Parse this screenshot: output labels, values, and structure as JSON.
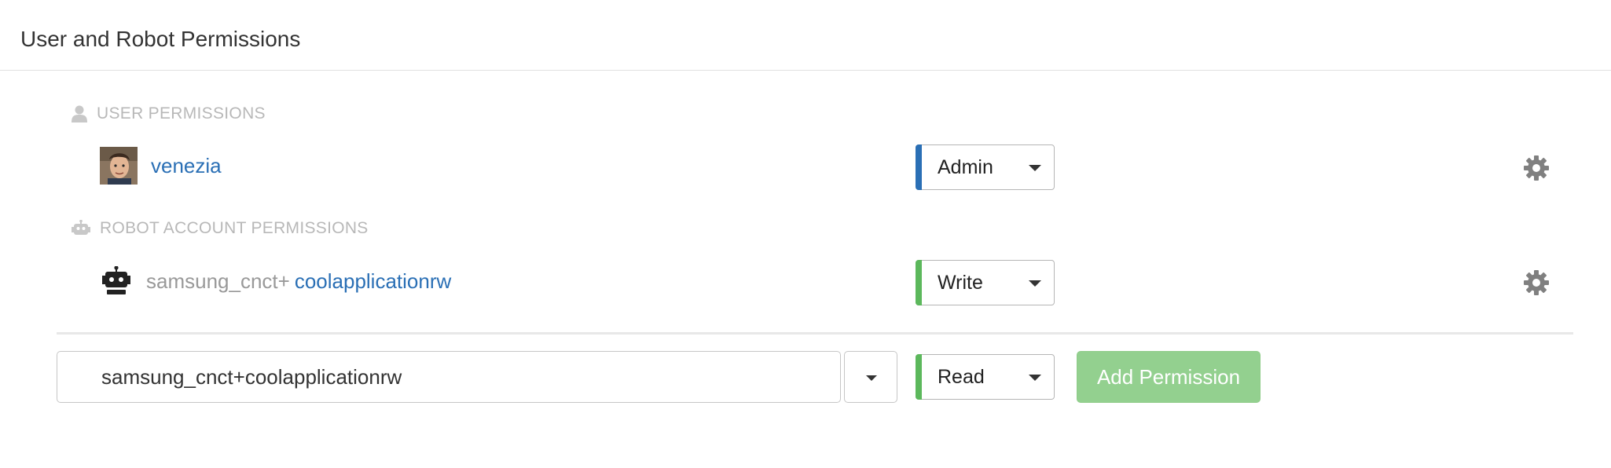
{
  "panel": {
    "title": "User and Robot Permissions"
  },
  "user_section": {
    "label": "USER PERMISSIONS",
    "rows": [
      {
        "name": "venezia",
        "role": "Admin",
        "role_color": "#2a6fb5"
      }
    ]
  },
  "robot_section": {
    "label": "ROBOT ACCOUNT PERMISSIONS",
    "rows": [
      {
        "prefix": "samsung_cnct+",
        "name": "coolapplicationrw",
        "role": "Write",
        "role_color": "#5cb85c"
      }
    ]
  },
  "add_form": {
    "entity_value": "samsung_cnct+coolapplicationrw",
    "role": "Read",
    "role_color": "#5cb85c",
    "submit_label": "Add Permission"
  },
  "colors": {
    "link": "#2a6fb5",
    "admin_accent": "#2a6fb5",
    "write_accent": "#5cb85c",
    "button": "#93d08f"
  },
  "icons": {
    "user_section": "user-icon",
    "robot_section": "robot-icon",
    "row_options": "gear-icon"
  }
}
